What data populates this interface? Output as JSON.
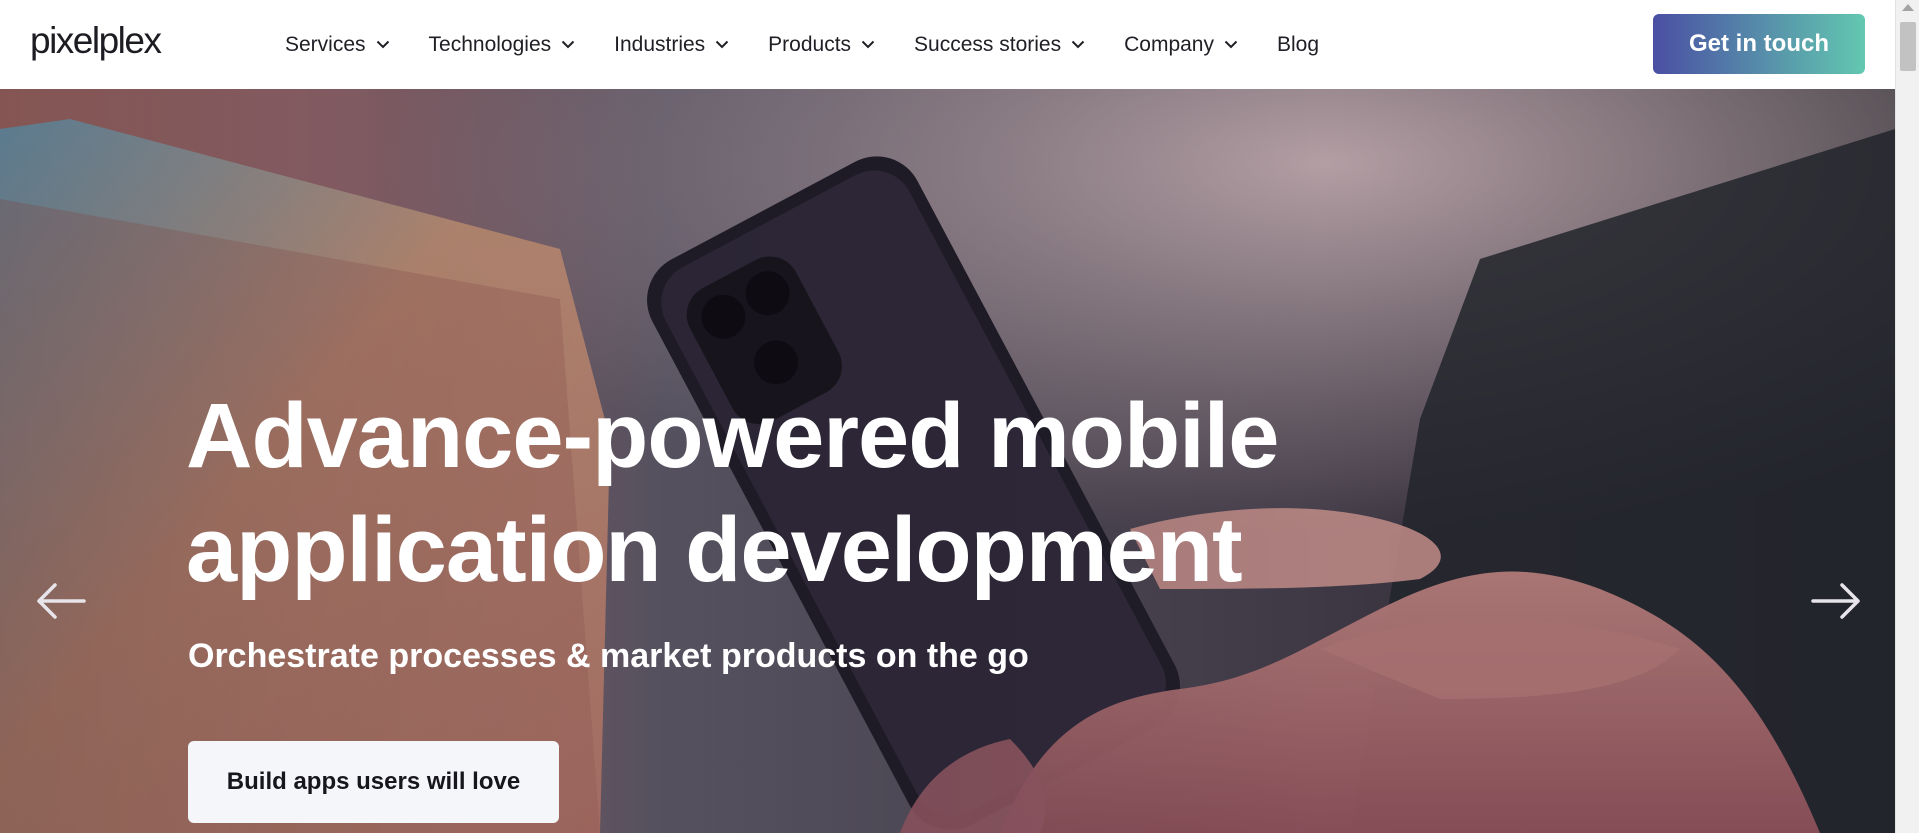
{
  "brand": {
    "logo": "pixelplex"
  },
  "nav": {
    "items": [
      {
        "label": "Services",
        "has_dropdown": true
      },
      {
        "label": "Technologies",
        "has_dropdown": true
      },
      {
        "label": "Industries",
        "has_dropdown": true
      },
      {
        "label": "Products",
        "has_dropdown": true
      },
      {
        "label": "Success stories",
        "has_dropdown": true
      },
      {
        "label": "Company",
        "has_dropdown": true
      },
      {
        "label": "Blog",
        "has_dropdown": false
      }
    ],
    "cta_label": "Get in touch"
  },
  "hero": {
    "title_line1": "Advance-powered mobile",
    "title_line2": "application development",
    "subtitle": "Orchestrate processes & market products on the go",
    "button_label": "Build apps users will love"
  },
  "icons": {
    "prev": "arrow-left-icon",
    "next": "arrow-right-icon",
    "dropdown": "chevron-down-icon"
  },
  "colors": {
    "cta_gradient_start": "#4a4fa3",
    "cta_gradient_end": "#62c8b0",
    "text_dark": "#1f1f25",
    "hero_text": "#ffffff"
  }
}
